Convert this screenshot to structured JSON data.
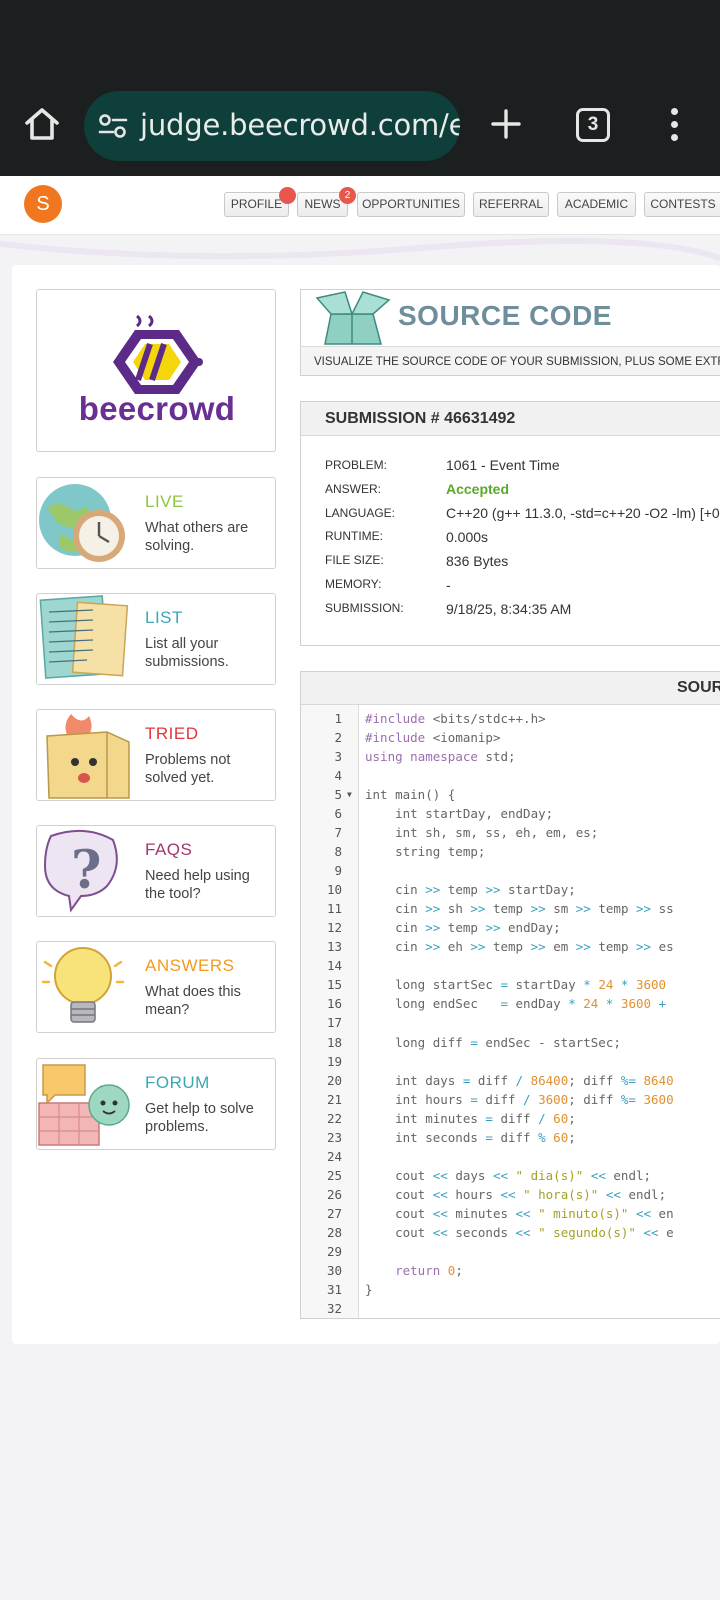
{
  "browser": {
    "url": "judge.beecrowd.com/en",
    "tab_count": "3"
  },
  "topnav": {
    "avatar_letter": "S",
    "buttons": [
      "PROFILE",
      "NEWS",
      "OPPORTUNITIES",
      "REFERRAL",
      "ACADEMIC",
      "CONTESTS"
    ],
    "news_badge": "2"
  },
  "sidebar": {
    "logo_text": "beecrowd",
    "cards": [
      {
        "title": "LIVE",
        "desc": "What others are solving.",
        "color": "#8cc63e"
      },
      {
        "title": "LIST",
        "desc": "List all your submissions.",
        "color": "#3aa7b8"
      },
      {
        "title": "TRIED",
        "desc": "Problems not solved yet.",
        "color": "#e2353a"
      },
      {
        "title": "FAQS",
        "desc": "Need help using the tool?",
        "color": "#a3366b"
      },
      {
        "title": "ANSWERS",
        "desc": "What does this mean?",
        "color": "#f29a1f"
      },
      {
        "title": "FORUM",
        "desc": "Get help to solve problems.",
        "color": "#3aa7b8"
      }
    ]
  },
  "source_code": {
    "title": "SOURCE CODE",
    "subtitle": "VISUALIZE THE SOURCE CODE OF YOUR SUBMISSION, PLUS SOME EXTRA D"
  },
  "submission": {
    "heading": "SUBMISSION # 46631492",
    "rows": [
      {
        "label": "PROBLEM:",
        "value": "1061 - Event Time"
      },
      {
        "label": "ANSWER:",
        "value": "Accepted"
      },
      {
        "label": "LANGUAGE:",
        "value": "C++20 (g++ 11.3.0, -std=c++20 -O2 -lm) [+0"
      },
      {
        "label": "RUNTIME:",
        "value": "0.000s"
      },
      {
        "label": "FILE SIZE:",
        "value": "836 Bytes"
      },
      {
        "label": "MEMORY:",
        "value": "-"
      },
      {
        "label": "SUBMISSION:",
        "value": "9/18/25, 8:34:35 AM"
      }
    ],
    "accepted_color": "#5ba82a"
  },
  "code_panel": {
    "heading": "SOUR",
    "lines": [
      "#include <bits/stdc++.h>",
      "#include <iomanip>",
      "using namespace std;",
      "",
      "int main() {",
      "    int startDay, endDay;",
      "    int sh, sm, ss, eh, em, es;",
      "    string temp;",
      "",
      "    cin >> temp >> startDay;",
      "    cin >> sh >> temp >> sm >> temp >> ss",
      "    cin >> temp >> endDay;",
      "    cin >> eh >> temp >> em >> temp >> es",
      "",
      "    long startSec = startDay * 24 * 3600",
      "    long endSec   = endDay * 24 * 3600 +",
      "",
      "    long diff = endSec - startSec;",
      "",
      "    int days = diff / 86400; diff %= 8640",
      "    int hours = diff / 3600; diff %= 3600",
      "    int minutes = diff / 60;",
      "    int seconds = diff % 60;",
      "",
      "    cout << days << \" dia(s)\" << endl;",
      "    cout << hours << \" hora(s)\" << endl;",
      "    cout << minutes << \" minuto(s)\" << en",
      "    cout << seconds << \" segundo(s)\" << e",
      "",
      "    return 0;",
      "}",
      ""
    ]
  }
}
